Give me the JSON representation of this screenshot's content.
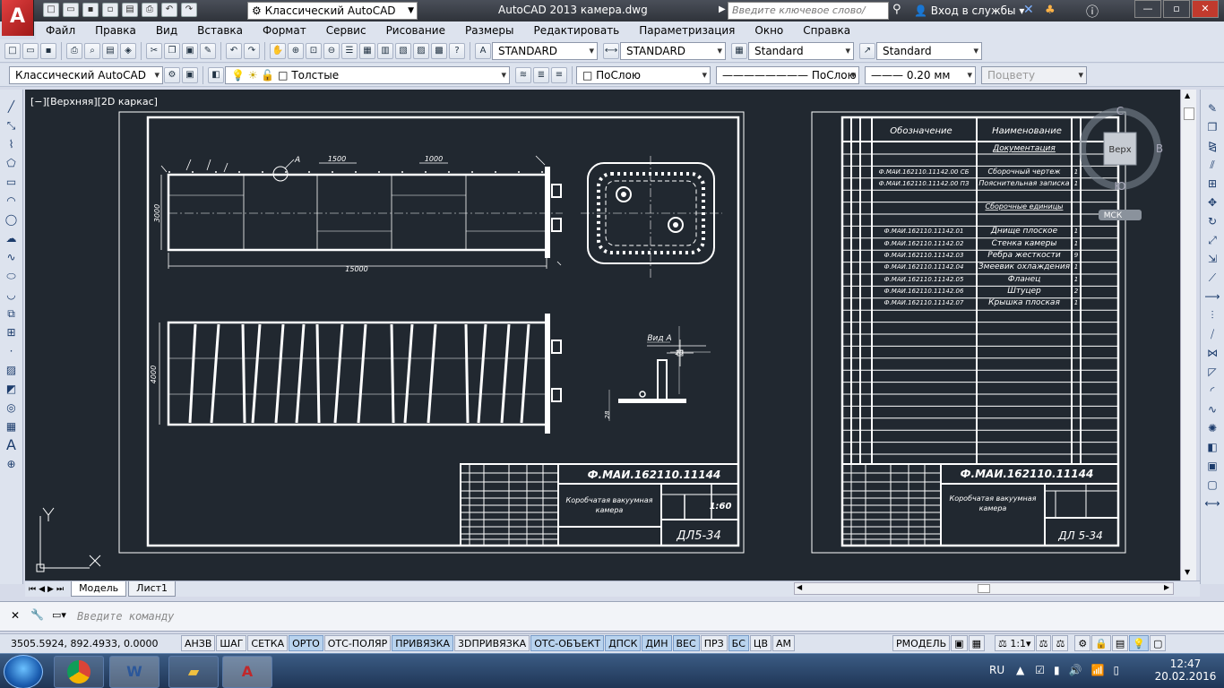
{
  "titlebar": {
    "workspace": "Классический AutoCAD",
    "app_title": "AutoCAD 2013    камера.dwg",
    "search_placeholder": "Введите ключевое слово/фразу",
    "signin": "Вход в службы"
  },
  "menu": [
    "Файл",
    "Правка",
    "Вид",
    "Вставка",
    "Формат",
    "Сервис",
    "Рисование",
    "Размеры",
    "Редактировать",
    "Параметризация",
    "Окно",
    "Справка"
  ],
  "toolbar1": {
    "text_style": "STANDARD",
    "dim_style": "STANDARD",
    "table_style": "Standard",
    "mleader_style": "Standard"
  },
  "toolbar2": {
    "workspace": "Классический AutoCAD",
    "layer": "Толстые",
    "color": "ПоСлою",
    "linetype": "ПоСлою",
    "lineweight": "0.20 мм",
    "plotstyle": "Поцвету"
  },
  "viewport": {
    "label": "[−][Верхняя][2D каркас]",
    "viewcube": {
      "top": "Верх",
      "north": "С",
      "south": "Ю",
      "east": "В",
      "ucs": "МСК"
    }
  },
  "drawing": {
    "dim_1500": "1500",
    "dim_1000": "1000",
    "dim_15000": "15000",
    "dim_3000": "3000",
    "dim_4000": "4000",
    "dim_28": "28",
    "dim_20": "20",
    "callout_a": "A",
    "view_a": "Вид А",
    "stamp_code": "Ф.МАИ.162110.11144",
    "stamp_name_1": "Коробчатая вакуумная",
    "stamp_name_2": "камера",
    "stamp_scale": "1:60",
    "stamp_group": "ДЛ5-34"
  },
  "spec": {
    "header_designation": "Обозначение",
    "header_name": "Наименование",
    "section_docs": "Документация",
    "section_assembly": "Сборочные единицы",
    "rows": [
      {
        "code": "Ф.МАИ.162110.11142.00 СБ",
        "name": "Сборочный чертеж",
        "qty": "1"
      },
      {
        "code": "Ф.МАИ.162110.11142.00 ПЗ",
        "name": "Пояснительная записка",
        "qty": "1"
      },
      {
        "code": "Ф.МАИ.162110.11142.01",
        "name": "Днище плоское",
        "qty": "1"
      },
      {
        "code": "Ф.МАИ.162110.11142.02",
        "name": "Стенка камеры",
        "qty": "1"
      },
      {
        "code": "Ф.МАИ.162110.11142.03",
        "name": "Ребра жесткости",
        "qty": "9"
      },
      {
        "code": "Ф.МАИ.162110.11142.04",
        "name": "Змеевик охлаждения",
        "qty": "1"
      },
      {
        "code": "Ф.МАИ.162110.11142.05",
        "name": "Фланец",
        "qty": "1"
      },
      {
        "code": "Ф.МАИ.162110.11142.06",
        "name": "Штуцер",
        "qty": "2"
      },
      {
        "code": "Ф.МАИ.162110.11142.07",
        "name": "Крышка плоская",
        "qty": "1"
      }
    ],
    "stamp_code": "Ф.МАИ.162110.11144",
    "stamp_name_1": "Коробчатая вакуумная",
    "stamp_name_2": "камера",
    "stamp_group": "ДЛ 5-34"
  },
  "tabs": [
    "Модель",
    "Лист1"
  ],
  "command": {
    "placeholder": "Введите команду"
  },
  "status": {
    "coords": "3505.5924, 892.4933, 0.0000",
    "buttons": [
      {
        "label": "АНЗВ",
        "on": false
      },
      {
        "label": "ШАГ",
        "on": false
      },
      {
        "label": "СЕТКА",
        "on": false
      },
      {
        "label": "ОРТО",
        "on": true
      },
      {
        "label": "ОТС-ПОЛЯР",
        "on": false
      },
      {
        "label": "ПРИВЯЗКА",
        "on": true
      },
      {
        "label": "3DПРИВЯЗКА",
        "on": false
      },
      {
        "label": "ОТС-ОБЪЕКТ",
        "on": true
      },
      {
        "label": "ДПСК",
        "on": true
      },
      {
        "label": "ДИН",
        "on": true
      },
      {
        "label": "ВЕС",
        "on": true
      },
      {
        "label": "ПРЗ",
        "on": false
      },
      {
        "label": "БС",
        "on": true
      },
      {
        "label": "ЦВ",
        "on": false
      },
      {
        "label": "АМ",
        "on": false
      }
    ],
    "model_space": "РМОДЕЛЬ",
    "annoscale": "1:1"
  },
  "taskbar": {
    "lang": "RU",
    "time": "12:47",
    "date": "20.02.2016"
  }
}
